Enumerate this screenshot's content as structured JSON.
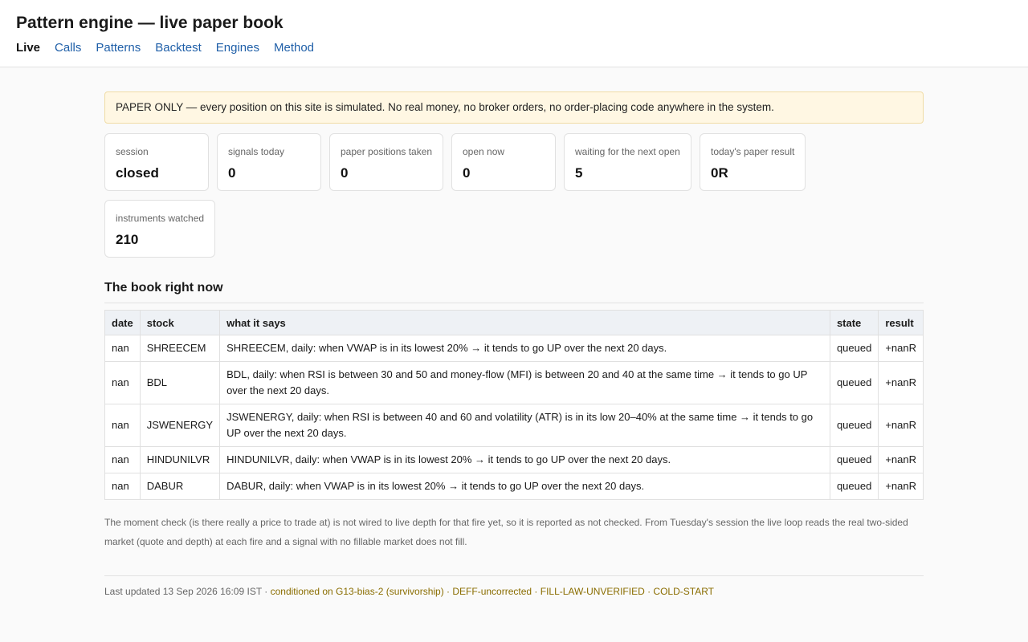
{
  "header": {
    "title": "Pattern engine — live paper book",
    "nav": [
      {
        "label": "Live",
        "active": true
      },
      {
        "label": "Calls"
      },
      {
        "label": "Patterns"
      },
      {
        "label": "Backtest"
      },
      {
        "label": "Engines"
      },
      {
        "label": "Method"
      }
    ]
  },
  "banner": "PAPER ONLY — every position on this site is simulated. No real money, no broker orders, no order-placing code anywhere in the system.",
  "stats": [
    {
      "label": "session",
      "value": "closed"
    },
    {
      "label": "signals today",
      "value": "0"
    },
    {
      "label": "paper positions taken",
      "value": "0"
    },
    {
      "label": "open now",
      "value": "0"
    },
    {
      "label": "waiting for the next open",
      "value": "5"
    },
    {
      "label": "today's paper result",
      "value": "0R"
    },
    {
      "label": "instruments watched",
      "value": "210"
    }
  ],
  "book": {
    "title": "The book right now",
    "columns": [
      "date",
      "stock",
      "what it says",
      "state",
      "result"
    ],
    "rows": [
      {
        "date": "nan",
        "stock": "SHREECEM",
        "says": "SHREECEM, daily: when VWAP is in its lowest 20% → it tends to go UP over the next 20 days.",
        "state": "queued",
        "result": "+nanR"
      },
      {
        "date": "nan",
        "stock": "BDL",
        "says": "BDL, daily: when RSI is between 30 and 50 and money-flow (MFI) is between 20 and 40 at the same time → it tends to go UP over the next 20 days.",
        "state": "queued",
        "result": "+nanR"
      },
      {
        "date": "nan",
        "stock": "JSWENERGY",
        "says": "JSWENERGY, daily: when RSI is between 40 and 60 and volatility (ATR) is in its low 20–40% at the same time → it tends to go UP over the next 20 days.",
        "state": "queued",
        "result": "+nanR"
      },
      {
        "date": "nan",
        "stock": "HINDUNILVR",
        "says": "HINDUNILVR, daily: when VWAP is in its lowest 20% → it tends to go UP over the next 20 days.",
        "state": "queued",
        "result": "+nanR"
      },
      {
        "date": "nan",
        "stock": "DABUR",
        "says": "DABUR, daily: when VWAP is in its lowest 20% → it tends to go UP over the next 20 days.",
        "state": "queued",
        "result": "+nanR"
      }
    ]
  },
  "note": "The moment check (is there really a price to trade at) is not wired to live depth for that fire yet, so it is reported as not checked. From Tuesday's session the live loop reads the real two-sided market (quote and depth) at each fire and a signal with no fillable market does not fill.",
  "footer": {
    "updated": "Last updated 13 Sep 2026 16:09 IST · ",
    "flags": "conditioned on G13-bias-2 (survivorship) · DEFF-uncorrected · FILL-LAW-UNVERIFIED · COLD-START"
  },
  "colors": {
    "link": "#1f5fa8",
    "banner_bg": "#fff7e3",
    "flag_text": "#8a6d00"
  }
}
